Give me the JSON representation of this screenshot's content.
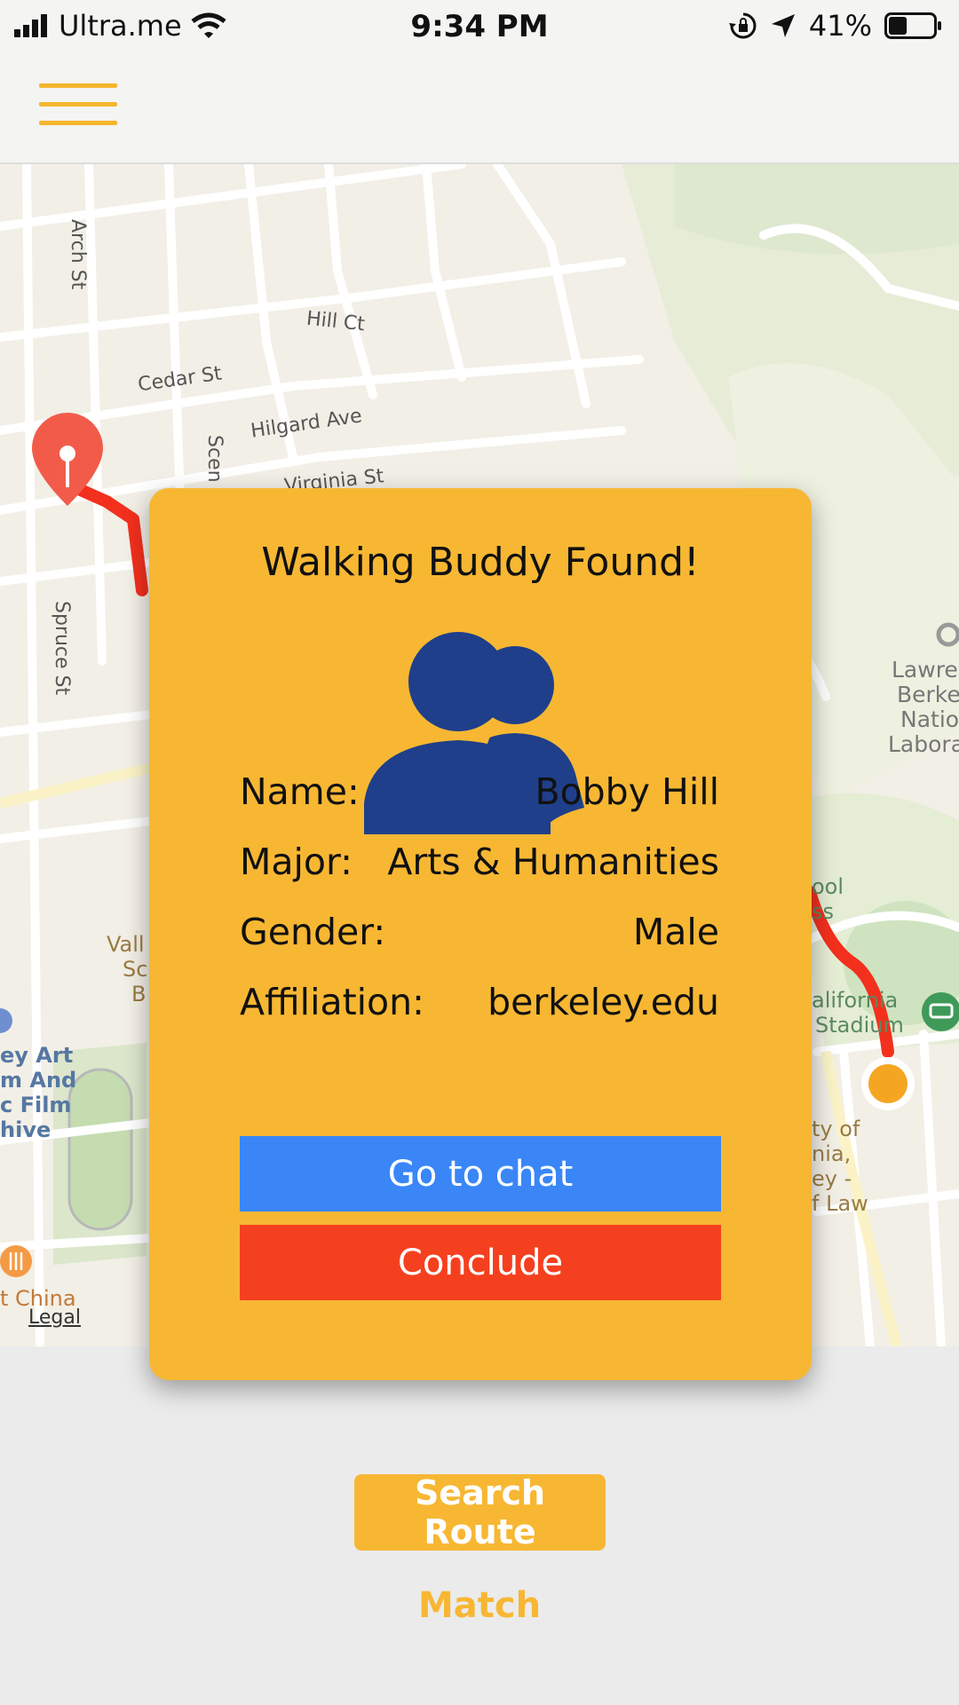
{
  "status_bar": {
    "carrier": "Ultra.me",
    "time": "9:34 PM",
    "battery": "41%",
    "battery_level": 0.41,
    "icons": [
      "signal-icon",
      "wifi-icon",
      "orientation-lock-icon",
      "location-arrow-icon",
      "battery-icon"
    ]
  },
  "header": {
    "menu_icon": "hamburger-menu-icon",
    "accent_color": "#f4b62d"
  },
  "map": {
    "street_labels": {
      "arch_st": "Arch St",
      "hill_ct": "Hill Ct",
      "cedar_st": "Cedar St",
      "hilgard_ave": "Hilgard Ave",
      "scenic": "Scen",
      "virginia_st": "Virginia St",
      "spruce_st": "Spruce St"
    },
    "poi_labels": {
      "lawrence_1": "Lawre",
      "lawrence_2": "Berke",
      "lawrence_3": "Natio",
      "lawrence_4": "Labora",
      "school_1": "ool",
      "school_2": "ss",
      "california_1": "alifornia",
      "california_2": "Stadium",
      "univ_1": "ty of",
      "univ_2": "nia,",
      "univ_3": "ey -",
      "univ_4": "f Law",
      "valley_1": "Vall",
      "valley_2": "Sc",
      "valley_3": "B",
      "art_1": "ey Art",
      "art_2": "m And",
      "art_3": "c Film",
      "art_4": "hive",
      "china": "t China"
    },
    "legal": "Legal",
    "route_color": "#f2301d",
    "pin_icon": "map-pin-icon",
    "destination_icon": "destination-dot-icon"
  },
  "buddy_card": {
    "title": "Walking Buddy Found!",
    "avatar_icon": "two-users-icon",
    "avatar_color": "#1f3f8a",
    "background_color": "#f7b733",
    "fields": {
      "name_label": "Name:",
      "name_value": "Bobby Hill",
      "major_label": "Major:",
      "major_value": "Arts & Humanities",
      "gender_label": "Gender:",
      "gender_value": "Male",
      "affiliation_label": "Affiliation:",
      "affiliation_value": "berkeley.edu"
    },
    "chat_button": "Go to chat",
    "chat_color": "#3a86f7",
    "conclude_button": "Conclude",
    "conclude_color": "#f5401f"
  },
  "bottom": {
    "search_route_button": "Search Route",
    "match_link": "Match"
  }
}
